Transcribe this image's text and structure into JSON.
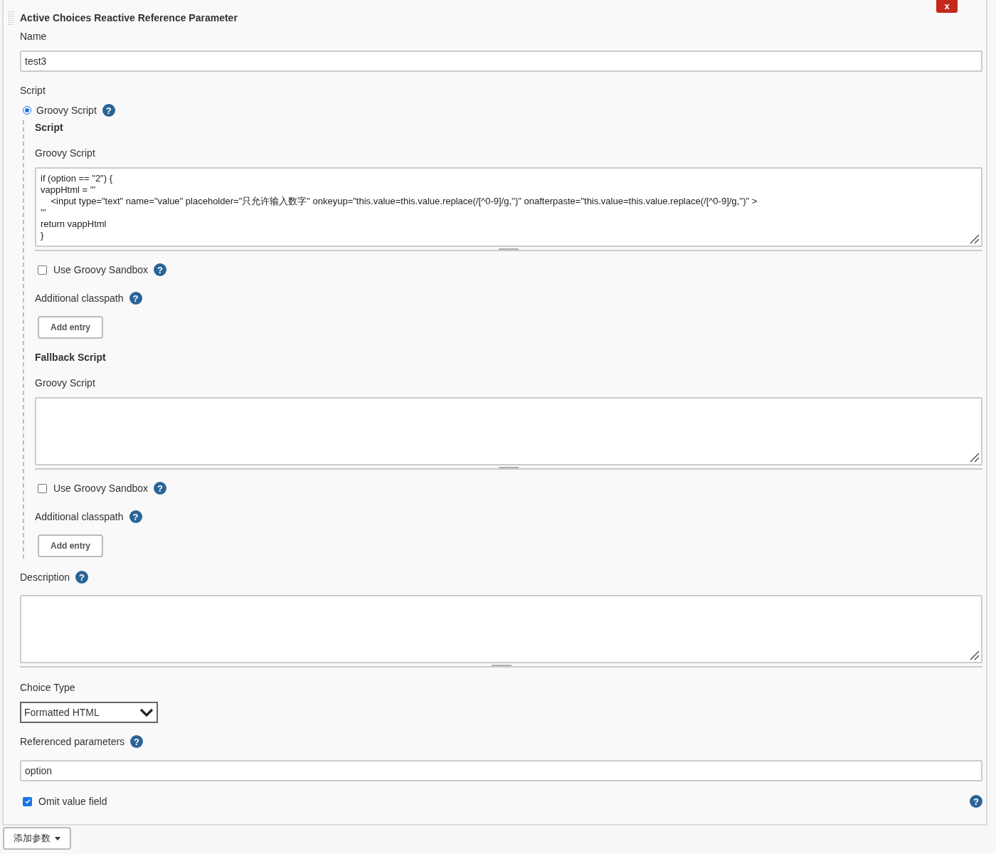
{
  "close_button": "x",
  "title": "Active Choices Reactive Reference Parameter",
  "name": {
    "label": "Name",
    "value": "test3"
  },
  "script_label": "Script",
  "script_types": [
    {
      "label": "Groovy Script",
      "selected": true,
      "help": "?"
    }
  ],
  "script_sections": [
    {
      "heading": "Script",
      "editor_label": "Groovy Script",
      "code": "if (option == \"2\") {\nvappHtml = '''\n    <input type=\"text\" name=\"value\" placeholder=\"只允许输入数字\" onkeyup=\"this.value=this.value.replace(/[^0-9]/g,'')\" onafterpaste=\"this.value=this.value.replace(/[^0-9]/g,'')\" >\n'''\nreturn vappHtml\n}",
      "sandbox": {
        "label": "Use Groovy Sandbox",
        "checked": false,
        "help": "?"
      },
      "classpath": {
        "label": "Additional classpath",
        "help": "?",
        "button": "Add entry"
      }
    },
    {
      "heading": "Fallback Script",
      "editor_label": "Groovy Script",
      "sandbox": {
        "label": "Use Groovy Sandbox",
        "checked": false,
        "help": "?"
      },
      "classpath": {
        "label": "Additional classpath",
        "help": "?",
        "button": "Add entry"
      }
    }
  ],
  "description": {
    "label": "Description",
    "help": "?"
  },
  "choice_type": {
    "label": "Choice Type",
    "value": "Formatted HTML"
  },
  "referenced": {
    "label": "Referenced parameters",
    "help": "?",
    "value": "option"
  },
  "omit": {
    "label": "Omit value field",
    "checked": true,
    "help": "?"
  },
  "add_button": "添加参数"
}
